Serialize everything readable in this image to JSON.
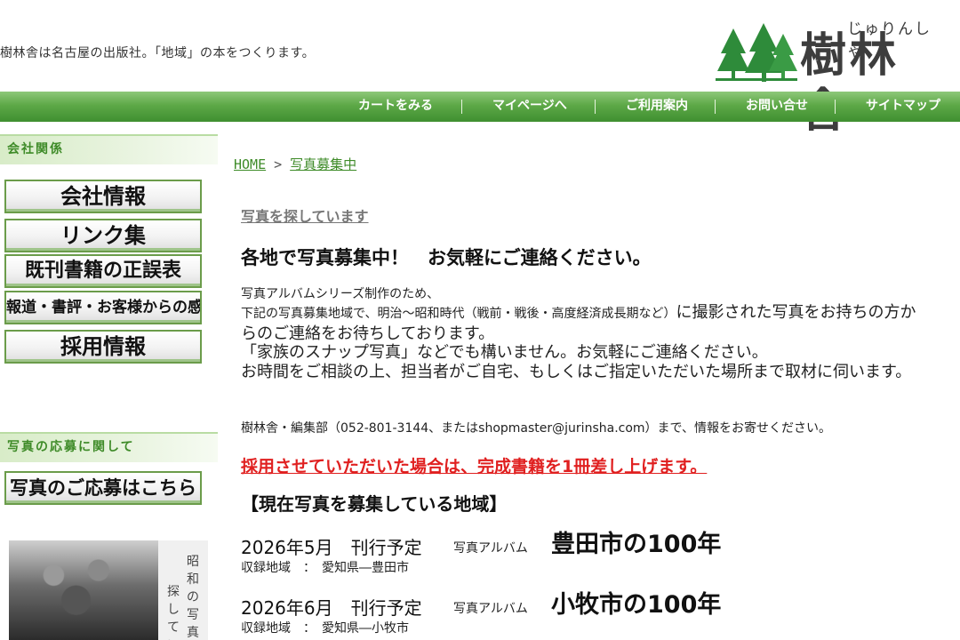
{
  "header": {
    "tagline": "樹林舎は名古屋の出版社。「地域」の本をつくります。",
    "logo_ruby": "じゅりんしゃ",
    "logo_text": "樹林舎"
  },
  "nav": {
    "items": [
      {
        "label": "カートをみる"
      },
      {
        "label": "マイページへ"
      },
      {
        "label": "ご利用案内"
      },
      {
        "label": "お問い合せ"
      },
      {
        "label": "サイトマップ"
      }
    ]
  },
  "sidebar": {
    "company_heading": "会社関係",
    "company_buttons": [
      {
        "label": "会社情報"
      },
      {
        "label": "リンク集"
      },
      {
        "label": "既刊書籍の正誤表"
      },
      {
        "label": "報道・書評・お客様からの感想"
      },
      {
        "label": "採用情報"
      }
    ],
    "photo_heading": "写真の応募に関して",
    "photo_button": "写真のご応募はこちら",
    "photo_banner_text_1": "昭和の写真",
    "photo_banner_text_2": "探してい"
  },
  "breadcrumb": {
    "home": "HOME",
    "separator": ">",
    "current": "写真募集中"
  },
  "main": {
    "section_title": "写真を探しています",
    "headline": "各地で写真募集中！　お気軽にご連絡ください。",
    "intro_line1": "写真アルバムシリーズ制作のため、",
    "body_small": "下記の写真募集地域で、明治～昭和時代（戦前・戦後・高度経済成長期など）",
    "body_large": "に撮影された写真をお持ちの方からのご連絡をお待ちしております。",
    "body_line2": "「家族のスナップ写真」などでも構いません。お気軽にご連絡ください。",
    "body_line3": "お時間をご相談の上、担当者がご自宅、もしくはご指定いただいた場所まで取材に伺います。",
    "contact": "樹林舎・編集部（052-801-3144、またはshopmaster@jurinsha.com）まで、情報をお寄せください。",
    "red_notice": "採用させていただいた場合は、完成書籍を1冊差し上げます。",
    "region_heading": "【現在写真を募集している地域】",
    "books": [
      {
        "date": "2026年5月　刊行予定",
        "series": "写真アルバム",
        "title": "豊田市の100年",
        "area": "収録地域　：　愛知県―豊田市"
      },
      {
        "date": "2026年6月　刊行予定",
        "series": "写真アルバム",
        "title": "小牧市の100年",
        "area": "収録地域　：　愛知県―小牧市"
      }
    ]
  },
  "colors": {
    "nav_green": "#5da847",
    "side_heading_text": "#3e8b28",
    "notice_red": "#e02020"
  }
}
